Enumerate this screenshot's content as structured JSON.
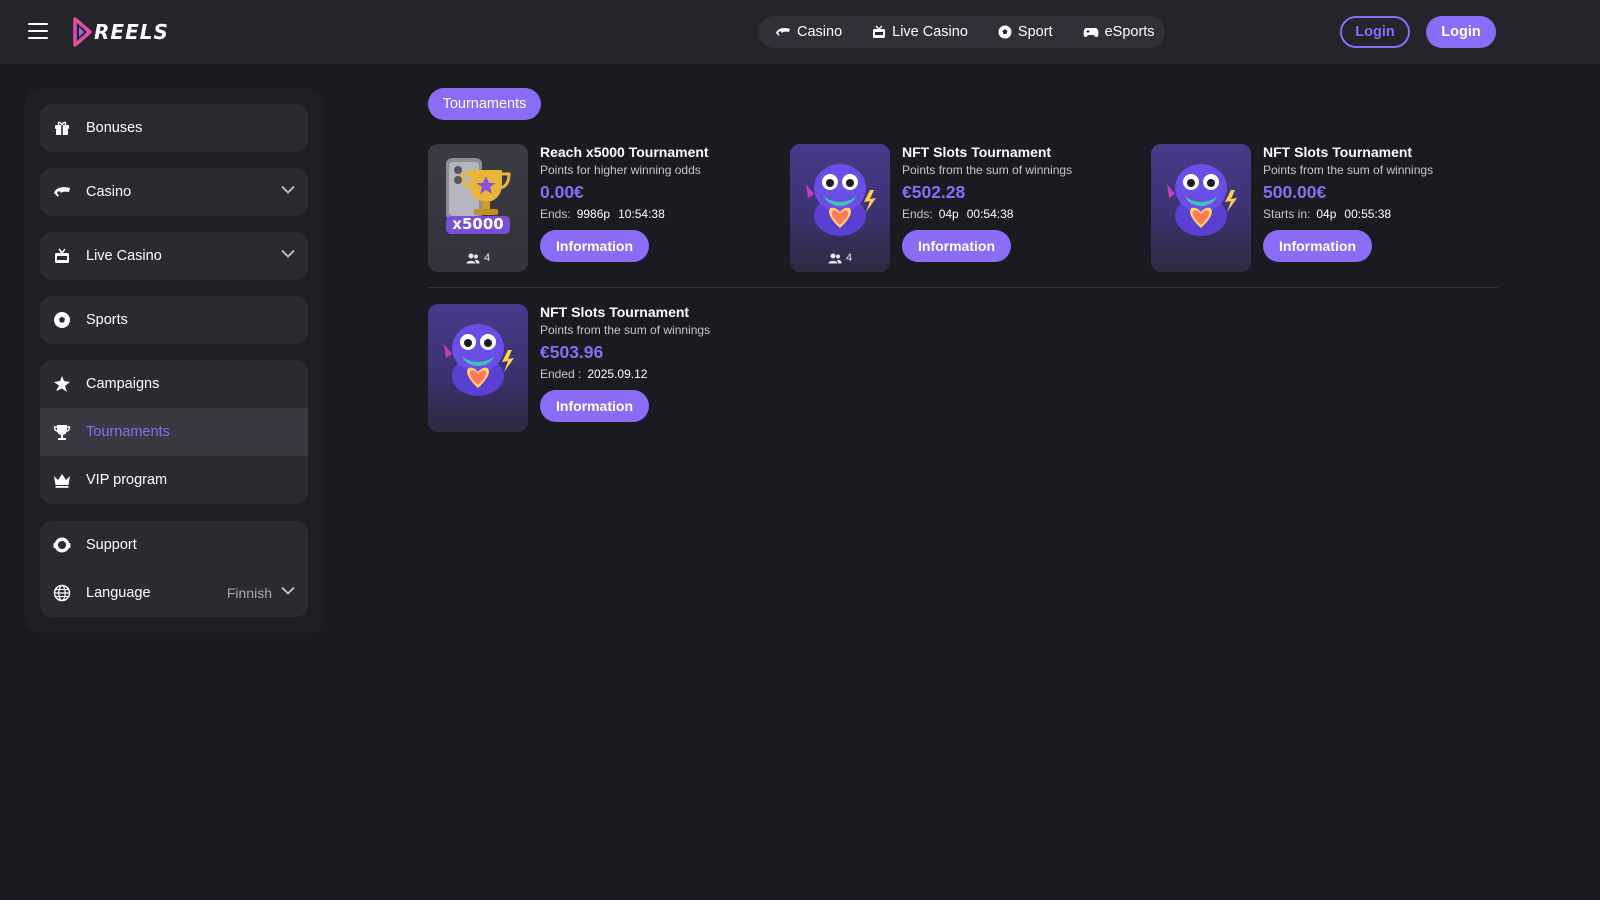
{
  "app": {
    "logo_text": "REELS"
  },
  "header": {
    "nav": [
      {
        "label": "Casino",
        "icon": "casino-icon"
      },
      {
        "label": "Live Casino",
        "icon": "live-casino-icon"
      },
      {
        "label": "Sport",
        "icon": "soccer-ball-icon"
      },
      {
        "label": "eSports",
        "icon": "gamepad-icon"
      }
    ],
    "login_outline": "Login",
    "login_filled": "Login"
  },
  "sidebar": {
    "bonuses": "Bonuses",
    "casino": "Casino",
    "live_casino": "Live Casino",
    "sports": "Sports",
    "campaigns": "Campaigns",
    "tournaments": "Tournaments",
    "vip": "VIP program",
    "support": "Support",
    "language": "Language",
    "language_value": "Finnish"
  },
  "main": {
    "section_badge": "Tournaments",
    "cards": [
      {
        "title": "Reach x5000 Tournament",
        "subtitle": "Points for higher winning odds",
        "prize": "0.00€",
        "time_label": "Ends:",
        "time_days": "9986p",
        "time_clock": "10:54:38",
        "players": "4",
        "thumb_text": "x5000",
        "button": "Information"
      },
      {
        "title": "NFT Slots Tournament",
        "subtitle": "Points from the sum of winnings",
        "prize": "€502.28",
        "time_label": "Ends:",
        "time_days": "04p",
        "time_clock": "00:54:38",
        "players": "4",
        "button": "Information"
      },
      {
        "title": "NFT Slots Tournament",
        "subtitle": "Points from the sum of winnings",
        "prize": "500.00€",
        "time_label": "Starts in:",
        "time_days": "04p",
        "time_clock": "00:55:38",
        "button": "Information"
      },
      {
        "title": "NFT Slots Tournament",
        "subtitle": "Points from the sum of winnings",
        "prize": "€503.96",
        "time_label": "Ended :",
        "time_days": "2025.09.12",
        "button": "Information"
      }
    ]
  },
  "colors": {
    "accent": "#8b6cf6",
    "background": "#1b1a20",
    "header": "#25242b",
    "panel": "#2b2a31"
  }
}
